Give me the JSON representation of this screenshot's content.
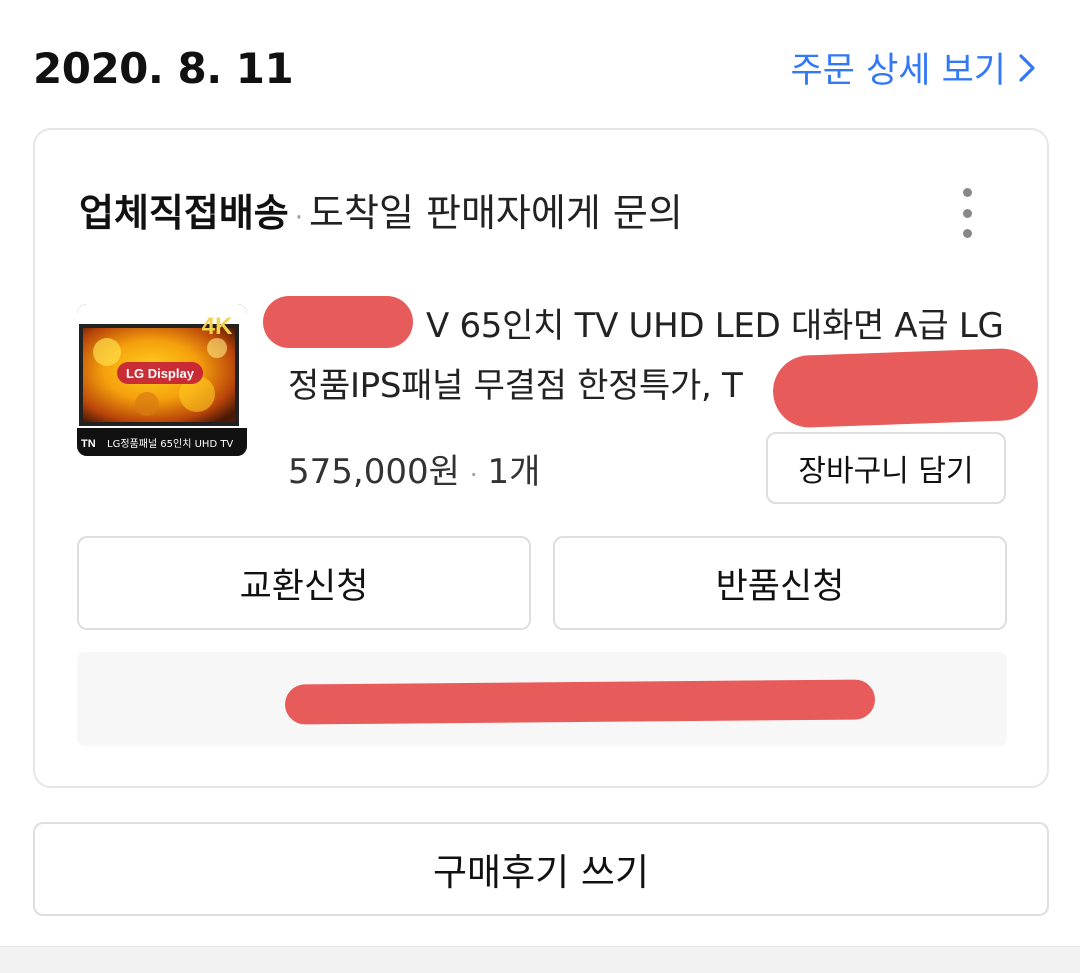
{
  "order": {
    "date": "2020. 8. 11",
    "detail_link": "주문 상세 보기"
  },
  "shipping": {
    "type": "업체직접배송",
    "status": "도착일 판매자에게 문의"
  },
  "product": {
    "title_line1": "V 65인치 TV UHD LED 대화면 A급 LG",
    "title_line2": "정품IPS패널 무결점 한정특가, T",
    "price": "575,000원",
    "quantity": "1개",
    "thumbnail_caption": "LG정품패널 65인치 UHD TV",
    "thumbnail_brand": "LG Display",
    "thumbnail_badge": "4K",
    "thumbnail_logo": "TN"
  },
  "buttons": {
    "add_to_cart": "장바구니 담기",
    "exchange": "교환신청",
    "return": "반품신청",
    "write_review": "구매후기 쓰기"
  },
  "colors": {
    "accent": "#3478f6",
    "redaction": "#e85b5b"
  },
  "icons": {
    "detail_link": "chevron-right-icon",
    "more": "more-vertical-icon"
  }
}
